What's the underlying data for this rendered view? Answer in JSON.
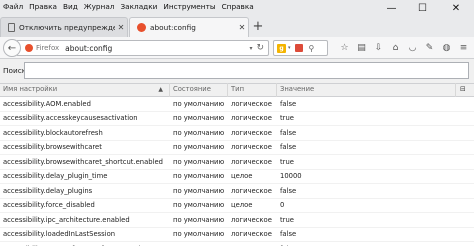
{
  "menu": {
    "items": [
      "Файл",
      "Правка",
      "Вид",
      "Журнал",
      "Закладки",
      "Инструменты",
      "Справка"
    ]
  },
  "window_controls": {
    "minimize": "—",
    "maximize": "☐",
    "close": "✕"
  },
  "tabs": [
    {
      "label": "Отключить предупрежде...",
      "close": "✕",
      "active": false
    },
    {
      "label": "about:config",
      "close": "✕",
      "active": true
    }
  ],
  "new_tab": "+",
  "navbar": {
    "back": "←",
    "identity_label": "Firefox",
    "url": "about:config",
    "dropdown": "▾",
    "reload": "↻",
    "search_engine_letter": "g",
    "search_dd": "▾",
    "search_icon": "⚲",
    "toolbar_icons": [
      "star-icon",
      "reading-list-icon",
      "downloads-icon",
      "home-icon",
      "pocket-icon",
      "eyedropper-icon",
      "addon-icon",
      "menu-icon"
    ],
    "toolbar_glyphs": [
      "☆",
      "▤",
      "⇩",
      "⌂",
      "◡",
      "✎",
      "◍",
      "≡"
    ]
  },
  "config_search": {
    "label": "Поиск:",
    "value": ""
  },
  "table": {
    "headers": {
      "name": "Имя настройки",
      "status": "Состояние",
      "type": "Тип",
      "value": "Значение",
      "sort_arrow": "▲",
      "column_picker": "⊟"
    },
    "rows": [
      {
        "name": "accessibility.AOM.enabled",
        "status": "по умолчанию",
        "type": "логическое",
        "value": "false"
      },
      {
        "name": "accessibility.accesskeycausesactivation",
        "status": "по умолчанию",
        "type": "логическое",
        "value": "true"
      },
      {
        "name": "accessibility.blockautorefresh",
        "status": "по умолчанию",
        "type": "логическое",
        "value": "false"
      },
      {
        "name": "accessibility.browsewithcaret",
        "status": "по умолчанию",
        "type": "логическое",
        "value": "false"
      },
      {
        "name": "accessibility.browsewithcaret_shortcut.enabled",
        "status": "по умолчанию",
        "type": "логическое",
        "value": "true"
      },
      {
        "name": "accessibility.delay_plugin_time",
        "status": "по умолчанию",
        "type": "целое",
        "value": "10000"
      },
      {
        "name": "accessibility.delay_plugins",
        "status": "по умолчанию",
        "type": "логическое",
        "value": "false"
      },
      {
        "name": "accessibility.force_disabled",
        "status": "по умолчанию",
        "type": "целое",
        "value": "0"
      },
      {
        "name": "accessibility.ipc_architecture.enabled",
        "status": "по умолчанию",
        "type": "логическое",
        "value": "true"
      },
      {
        "name": "accessibility.loadedInLastSession",
        "status": "по умолчанию",
        "type": "логическое",
        "value": "false"
      },
      {
        "name": "accessibility.mouse_focuses_formcontrol",
        "status": "по умолчанию",
        "type": "логическое",
        "value": "false"
      }
    ]
  }
}
